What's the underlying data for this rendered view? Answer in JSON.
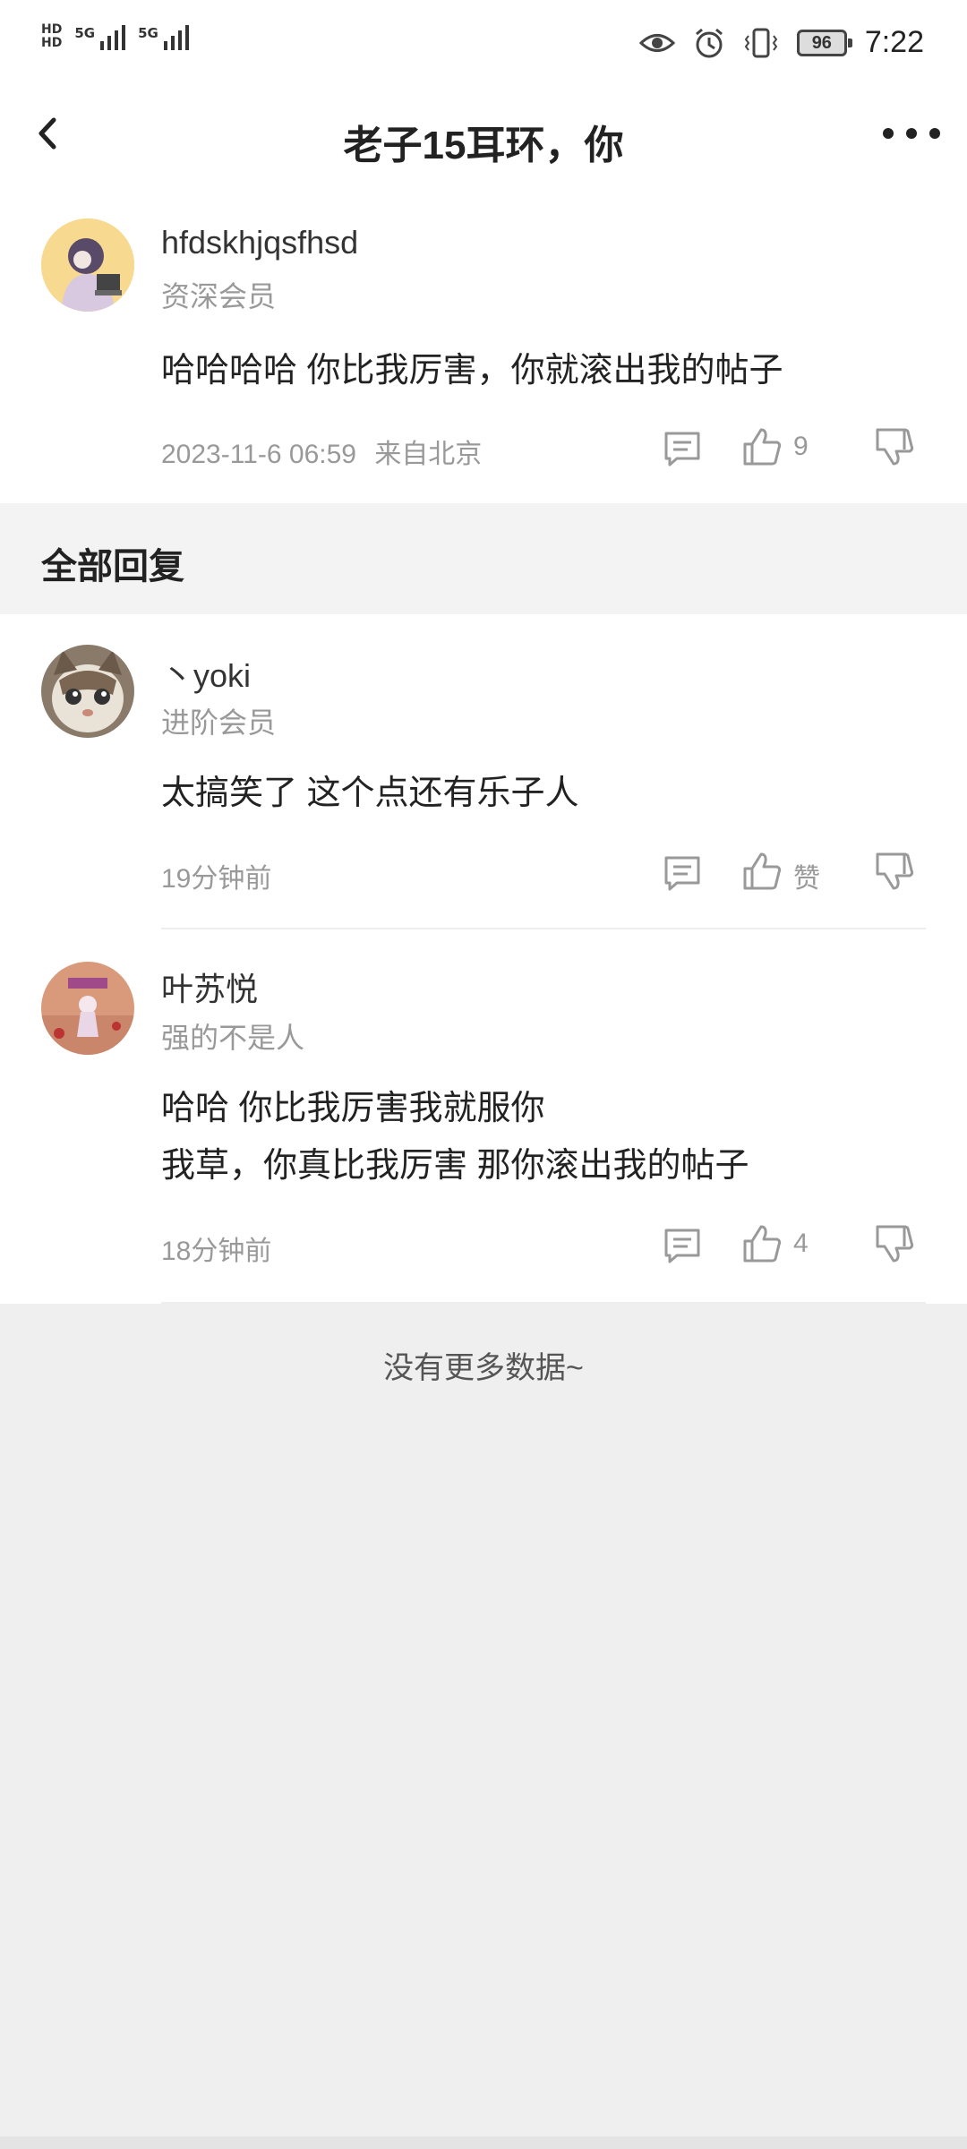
{
  "status_bar": {
    "hd1": "HD",
    "hd2": "HD",
    "net1": "5G",
    "net2": "5G",
    "battery": "96",
    "time": "7:22"
  },
  "header": {
    "title": "老子15耳环，你"
  },
  "post": {
    "username": "hfdskhjqsfhsd",
    "level": "资深会员",
    "content": "哈哈哈哈 你比我厉害，你就滚出我的帖子",
    "time": "2023-11-6 06:59",
    "location": "来自北京",
    "likes": "9"
  },
  "section_title": "全部回复",
  "replies": [
    {
      "username": "丶yoki",
      "level": "进阶会员",
      "content": [
        "太搞笑了  这个点还有乐子人"
      ],
      "time": "19分钟前",
      "likes": "赞"
    },
    {
      "username": "叶苏悦",
      "level": "强的不是人",
      "content": [
        "哈哈 你比我厉害我就服你",
        "我草，你真比我厉害 那你滚出我的帖子"
      ],
      "time": "18分钟前",
      "likes": "4"
    }
  ],
  "footer_text": "没有更多数据~"
}
